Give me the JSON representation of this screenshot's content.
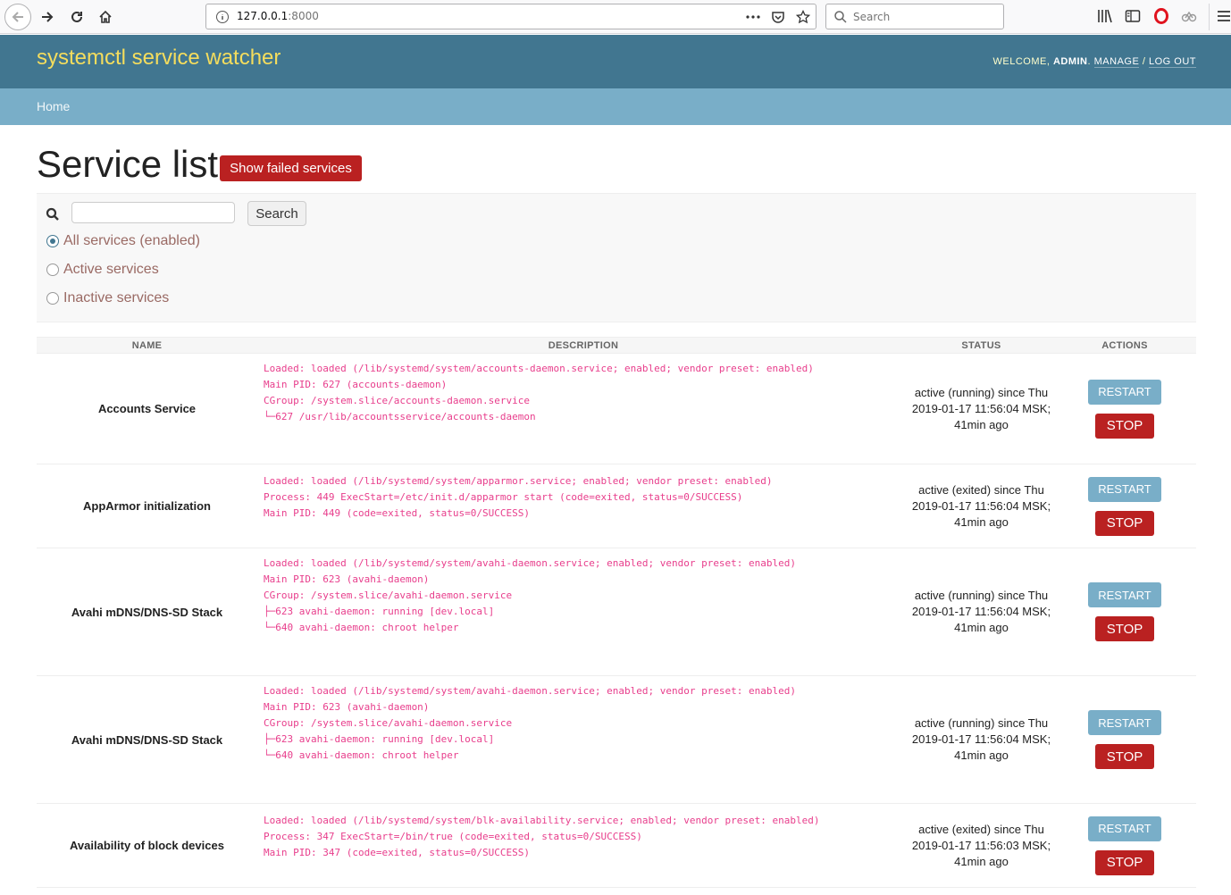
{
  "browser": {
    "url_host": "127.0.0.1",
    "url_port": ":8000",
    "search_placeholder": "Search"
  },
  "header": {
    "brand": "systemctl service watcher",
    "welcome": "WELCOME, ",
    "user": "ADMIN",
    "dot": ". ",
    "manage": "MANAGE",
    "sep": " / ",
    "logout": "LOG OUT"
  },
  "breadcrumbs": {
    "home": "Home"
  },
  "main": {
    "title": "Service list",
    "failed_button": "Show failed services",
    "search_button": "Search",
    "filters": [
      {
        "label": "All services (enabled)",
        "checked": true
      },
      {
        "label": "Active services",
        "checked": false
      },
      {
        "label": "Inactive services",
        "checked": false
      }
    ]
  },
  "table": {
    "headers": {
      "name": "NAME",
      "description": "DESCRIPTION",
      "status": "STATUS",
      "actions": "ACTIONS"
    },
    "restart_label": "RESTART",
    "stop_label": "STOP",
    "rows": [
      {
        "name": "Accounts Service",
        "desc": [
          "Loaded: loaded (/lib/systemd/system/accounts-daemon.service; enabled; vendor preset: enabled)",
          "Main PID: 627 (accounts-daemon)",
          "CGroup: /system.slice/accounts-daemon.service",
          "└─627 /usr/lib/accountsservice/accounts-daemon"
        ],
        "status": [
          "active (running) since Thu",
          "2019-01-17 11:56:04 MSK;",
          "41min ago"
        ]
      },
      {
        "name": "AppArmor initialization",
        "desc": [
          "Loaded: loaded (/lib/systemd/system/apparmor.service; enabled; vendor preset: enabled)",
          "Process: 449 ExecStart=/etc/init.d/apparmor start (code=exited, status=0/SUCCESS)",
          "Main PID: 449 (code=exited, status=0/SUCCESS)"
        ],
        "status": [
          "active (exited) since Thu",
          "2019-01-17 11:56:04 MSK;",
          "41min ago"
        ]
      },
      {
        "name": "Avahi mDNS/DNS-SD Stack",
        "desc": [
          "Loaded: loaded (/lib/systemd/system/avahi-daemon.service; enabled; vendor preset: enabled)",
          "Main PID: 623 (avahi-daemon)",
          "CGroup: /system.slice/avahi-daemon.service",
          "├─623 avahi-daemon: running [dev.local]",
          "└─640 avahi-daemon: chroot helper"
        ],
        "status": [
          "active (running) since Thu",
          "2019-01-17 11:56:04 MSK;",
          "41min ago"
        ]
      },
      {
        "name": "Avahi mDNS/DNS-SD Stack",
        "desc": [
          "Loaded: loaded (/lib/systemd/system/avahi-daemon.service; enabled; vendor preset: enabled)",
          "Main PID: 623 (avahi-daemon)",
          "CGroup: /system.slice/avahi-daemon.service",
          "├─623 avahi-daemon: running [dev.local]",
          "└─640 avahi-daemon: chroot helper"
        ],
        "status": [
          "active (running) since Thu",
          "2019-01-17 11:56:04 MSK;",
          "41min ago"
        ]
      },
      {
        "name": "Availability of block devices",
        "desc": [
          "Loaded: loaded (/lib/systemd/system/blk-availability.service; enabled; vendor preset: enabled)",
          "Process: 347 ExecStart=/bin/true (code=exited, status=0/SUCCESS)",
          "Main PID: 347 (code=exited, status=0/SUCCESS)"
        ],
        "status": [
          "active (exited) since Thu",
          "2019-01-17 11:56:03 MSK;",
          "41min ago"
        ]
      }
    ]
  }
}
